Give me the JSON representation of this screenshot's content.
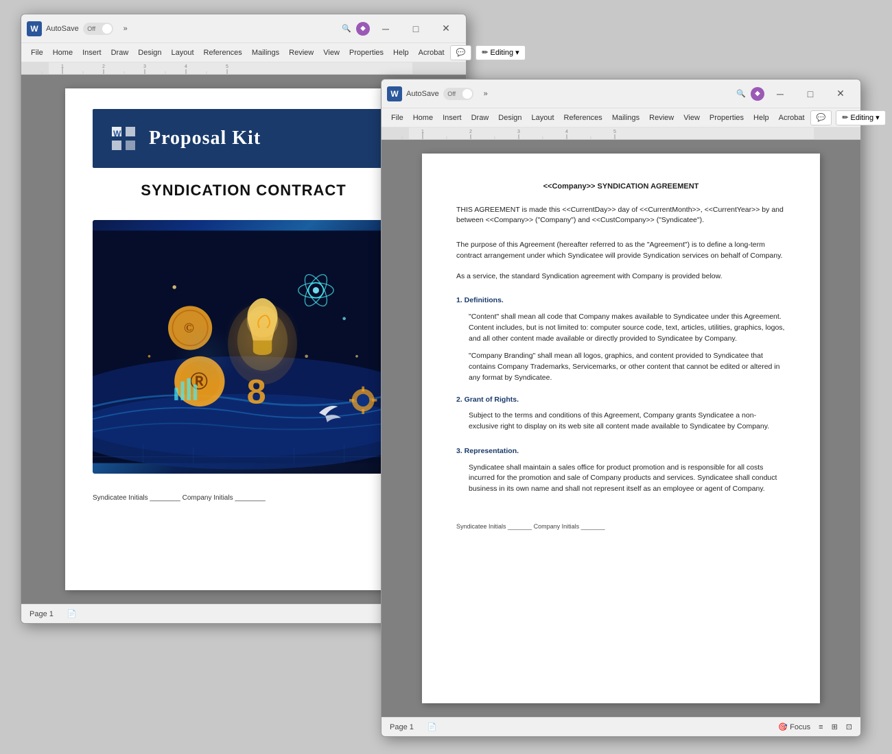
{
  "window1": {
    "title": "AutoSave",
    "toggle_state": "Off",
    "menu_items": [
      "File",
      "Home",
      "Insert",
      "Draw",
      "Design",
      "Layout",
      "References",
      "Mailings",
      "Review",
      "View",
      "Properties",
      "Help",
      "Acrobat"
    ],
    "editing_label": "Editing",
    "comment_icon": "💬",
    "pencil_icon": "✏",
    "page_label": "Page 1",
    "status_icons": [
      "📄",
      "🎯",
      "≡",
      "⊞",
      "⊡"
    ],
    "cover": {
      "logo_text": "Proposal Kit",
      "title": "SYNDICATION CONTRACT",
      "initials_text": "Syndicatee Initials ________ Company Initials ________"
    }
  },
  "window2": {
    "title": "AutoSave",
    "toggle_state": "Off",
    "menu_items": [
      "File",
      "Home",
      "Insert",
      "Draw",
      "Design",
      "Layout",
      "References",
      "Mailings",
      "Review",
      "View",
      "Properties",
      "Help",
      "Acrobat"
    ],
    "editing_label": "Editing",
    "comment_icon": "💬",
    "pencil_icon": "✏",
    "page_label": "Page 1",
    "content": {
      "doc_title": "<<Company>> SYNDICATION AGREEMENT",
      "para1": "THIS AGREEMENT is made this <<CurrentDay>> day of <<CurrentMonth>>, <<CurrentYear>> by and between <<Company>> (\"Company\") and <<CustCompany>> (\"Syndicatee\").",
      "para2": "The purpose of this Agreement (hereafter referred to as the \"Agreement\") is to define a long-term contract arrangement under which Syndicatee will provide Syndication services on behalf of Company.",
      "para3": "As a service, the standard Syndication agreement with Company is provided below.",
      "section1_title": "1. Definitions.",
      "section1_p1": "\"Content\" shall mean all code that Company makes available to Syndicatee under this Agreement. Content includes, but is not limited to: computer source code, text, articles, utilities, graphics, logos, and all other content made available or directly provided to Syndicatee by Company.",
      "section1_p2": "\"Company Branding\" shall mean all logos, graphics, and content provided to Syndicatee that contains Company Trademarks, Servicemarks, or other content that cannot be edited or altered in any format by Syndicatee.",
      "section2_title": "2. Grant of Rights.",
      "section2_p1": "Subject to the terms and conditions of this Agreement, Company grants Syndicatee a non-exclusive right to display on its web site all content made available to Syndicatee by Company.",
      "section3_title": "3. Representation.",
      "section3_p1": "Syndicatee shall maintain a sales office for product promotion and is responsible for all costs incurred for the promotion and sale of Company products and services. Syndicatee shall conduct business in its own name and shall not represent itself as an employee or agent of Company.",
      "initials_text": "Syndicatee Initials _______ Company Initials _______"
    }
  },
  "colors": {
    "word_blue": "#2b579a",
    "header_blue": "#1a3a6b",
    "accent_blue": "#1a5fa0"
  }
}
